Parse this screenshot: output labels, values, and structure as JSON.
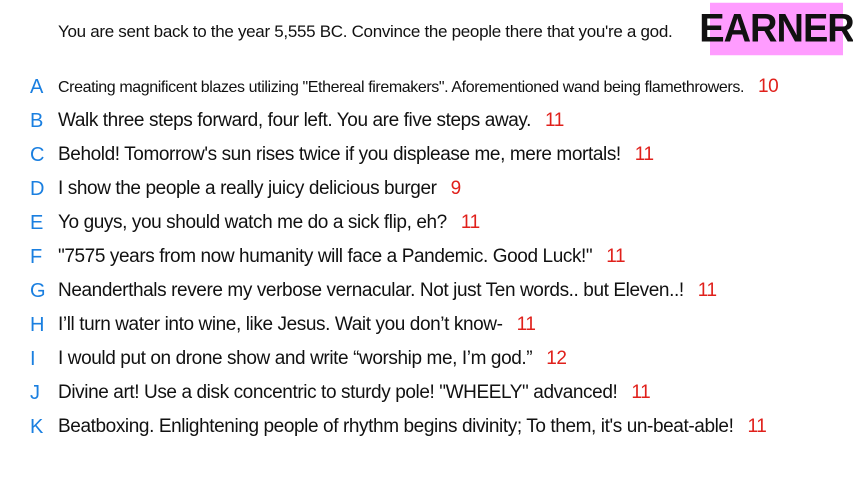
{
  "prompt": "You are sent back to the year 5,555 BC. Convince the people there that you're a god.",
  "badge": "EARNER",
  "colors": {
    "badge_bg": "#ff9cff",
    "letter": "#1a7fe0",
    "count": "#e0201b",
    "text": "#111111"
  },
  "answers": [
    {
      "letter": "A",
      "text": "Creating magnificent blazes utilizing \"Ethereal firemakers\". Aforementioned wand being flamethrowers.",
      "count": "10"
    },
    {
      "letter": "B",
      "text": "Walk three steps forward, four left. You are five steps away.",
      "count": "11"
    },
    {
      "letter": "C",
      "text": "Behold! Tomorrow's sun rises twice if you displease me, mere mortals!",
      "count": "11"
    },
    {
      "letter": "D",
      "text": "I show the people a really juicy delicious burger",
      "count": "9"
    },
    {
      "letter": "E",
      "text": "Yo guys, you should watch me do a sick flip, eh?",
      "count": "11"
    },
    {
      "letter": "F",
      "text": "\"7575 years from now humanity will face a Pandemic. Good Luck!\"",
      "count": "11"
    },
    {
      "letter": "G",
      "text": "Neanderthals revere my verbose vernacular. Not just Ten words.. but Eleven..!",
      "count": "11"
    },
    {
      "letter": "H",
      "text": "I’ll turn water into wine, like Jesus. Wait you don’t know-",
      "count": "11"
    },
    {
      "letter": "I",
      "text": "I would put on drone show and write “worship me, I’m god.”",
      "count": "12"
    },
    {
      "letter": "J",
      "text": "Divine art! Use a disk concentric to sturdy pole! \"WHEELY\" advanced!",
      "count": "11"
    },
    {
      "letter": "K",
      "text": "Beatboxing. Enlightening people of rhythm begins divinity; To them, it's un-beat-able!",
      "count": "11"
    }
  ]
}
